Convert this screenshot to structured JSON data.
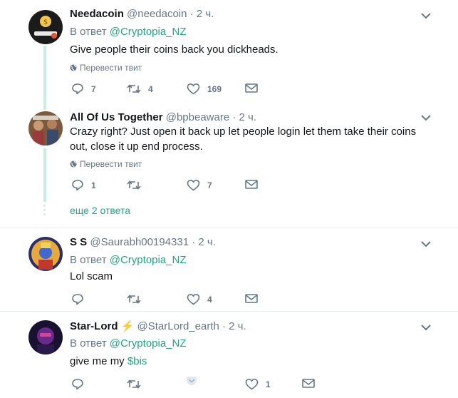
{
  "colors": {
    "accent": "#1da882",
    "muted": "#657786",
    "text": "#14171a",
    "thread": "#c7eedf",
    "divider": "#e6ecf0"
  },
  "tweets": [
    {
      "name": "Needacoin",
      "handle": "@needacoin",
      "dot": "·",
      "time": "2 ч.",
      "reply_prefix": "В ответ",
      "reply_mention": "@Cryptopia_NZ",
      "text": "Give people their coins back you dickheads.",
      "translate": "Перевести твит",
      "replies": "7",
      "retweets": "4",
      "likes": "169"
    },
    {
      "name": "All Of Us Together",
      "handle": "@bpbeaware",
      "dot": "·",
      "time": "2 ч.",
      "text": "Crazy right? Just open it back up let people login let them take their coins out, close it up end process.",
      "translate": "Перевести твит",
      "replies": "1",
      "retweets": "",
      "likes": "7"
    },
    {
      "name": "S S",
      "handle": "@Saurabh00194331",
      "dot": "·",
      "time": "2 ч.",
      "reply_prefix": "В ответ",
      "reply_mention": "@Cryptopia_NZ",
      "text": "Lol scam",
      "replies": "",
      "retweets": "",
      "likes": "4"
    },
    {
      "name": "Star-Lord",
      "name_emoji": "⚡",
      "handle": "@StarLord_earth",
      "dot": "·",
      "time": "2 ч.",
      "reply_prefix": "В ответ",
      "reply_mention": "@Cryptopia_NZ",
      "text_prefix": "give me my",
      "cashtag": "$bis",
      "replies": "",
      "retweets": "",
      "likes": "1"
    }
  ],
  "show_more": "еще 2 ответа"
}
